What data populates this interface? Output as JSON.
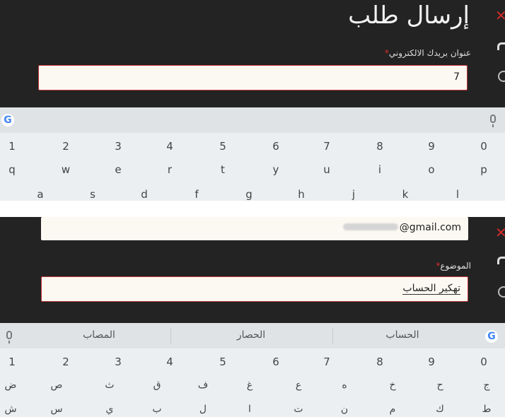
{
  "top": {
    "title": "إرسال طلب",
    "email_label": "عنوان بريدك الالكتروني",
    "required_mark": "*",
    "email_value": "7",
    "keyboard": {
      "logo": "G",
      "numbers": [
        "1",
        "2",
        "3",
        "4",
        "5",
        "6",
        "7",
        "8",
        "9",
        "0"
      ],
      "row1": [
        "q",
        "w",
        "e",
        "r",
        "t",
        "y",
        "u",
        "i",
        "o",
        "p"
      ],
      "row2": [
        "a",
        "s",
        "d",
        "f",
        "g",
        "h",
        "j",
        "k",
        "l"
      ]
    }
  },
  "bottom": {
    "email_value": "@gmail.com",
    "subject_label": "الموضوع",
    "required_mark": "*",
    "subject_value": "تهكير الحساب",
    "keyboard": {
      "logo": "G",
      "suggestions": [
        "المصاب",
        "الحصار",
        "الحساب"
      ],
      "numbers": [
        "1",
        "2",
        "3",
        "4",
        "5",
        "6",
        "7",
        "8",
        "9",
        "0"
      ],
      "row1": [
        "ض",
        "ص",
        "ث",
        "ق",
        "ف",
        "غ",
        "ع",
        "ه",
        "خ",
        "ح",
        "ج"
      ],
      "row2": [
        "ش",
        "س",
        "ي",
        "ب",
        "ل",
        "ا",
        "ت",
        "ن",
        "م",
        "ك",
        "ط"
      ]
    }
  },
  "colors": {
    "accent": "#c23b3b",
    "close": "#d12a2a",
    "google_blue": "#4285f4"
  },
  "icons": [
    "close-icon",
    "google-icon",
    "mic-icon"
  ]
}
